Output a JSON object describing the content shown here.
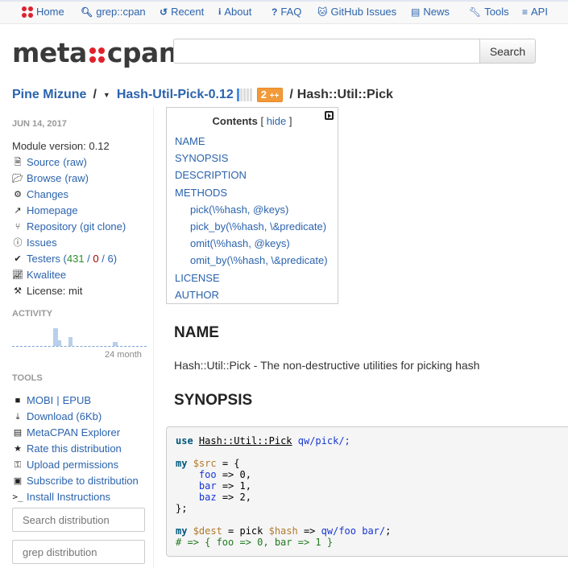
{
  "topnav": {
    "items": [
      {
        "label": "Home",
        "icon": "metacpan-dots-icon"
      },
      {
        "label": "grep::cpan",
        "icon": "search-icon"
      },
      {
        "label": "Recent",
        "icon": "history-icon"
      },
      {
        "label": "About",
        "icon": "info-icon"
      },
      {
        "label": "FAQ",
        "icon": "question-icon"
      },
      {
        "label": "GitHub Issues",
        "icon": "github-icon"
      },
      {
        "label": "News",
        "icon": "newspaper-icon"
      },
      {
        "label": "Tools",
        "icon": "wrench-icon"
      },
      {
        "label": "API",
        "icon": "database-icon"
      }
    ]
  },
  "header": {
    "logo_left": "meta",
    "logo_right": "cpan",
    "search_value": "",
    "search_button": "Search"
  },
  "breadcrumb": {
    "author": "Pine Mizune",
    "separator": "/",
    "release": "Hash-Util-Pick-0.12",
    "plusplus_count": "2",
    "plusplus_suffix": "++",
    "module": "Hash::Util::Pick",
    "rating_filled": 1,
    "rating_total": 5
  },
  "sidebar": {
    "date": "JUN 14, 2017",
    "module_version": "Module version: 0.12",
    "links": {
      "source": "Source",
      "source_raw": "(raw)",
      "browse": "Browse",
      "browse_raw": "(raw)",
      "changes": "Changes",
      "homepage": "Homepage",
      "repository": "Repository",
      "git_clone": "(git clone)",
      "issues": "Issues",
      "testers": "Testers",
      "testers_pass": "431",
      "testers_fail": "0",
      "testers_na": "6",
      "kwalitee": "Kwalitee",
      "license": "License: mit"
    },
    "activity_heading": "ACTIVITY",
    "activity_label": "24 month",
    "activity_values": [
      0,
      0,
      0,
      0,
      0,
      0,
      0,
      0,
      0,
      0,
      0,
      5,
      1.5,
      0,
      0,
      2.5,
      0,
      0,
      0,
      0,
      0,
      0,
      0,
      0,
      0,
      0,
      0,
      1.2,
      0,
      0,
      0,
      0,
      0,
      0,
      0,
      0
    ],
    "tools_heading": "TOOLS",
    "tools": {
      "mobi": "MOBI",
      "sep": "|",
      "epub": "EPUB",
      "download": "Download (6Kb)",
      "explorer": "MetaCPAN Explorer",
      "rate": "Rate this distribution",
      "permissions": "Upload permissions",
      "subscribe": "Subscribe to distribution",
      "install": "Install Instructions"
    },
    "search_dist_placeholder": "Search distribution",
    "grep_dist_placeholder": "grep distribution"
  },
  "toc": {
    "title": "Contents",
    "hide": "hide",
    "items": [
      {
        "label": "NAME",
        "sub": false
      },
      {
        "label": "SYNOPSIS",
        "sub": false
      },
      {
        "label": "DESCRIPTION",
        "sub": false
      },
      {
        "label": "METHODS",
        "sub": false
      },
      {
        "label": "pick(\\%hash, @keys)",
        "sub": true
      },
      {
        "label": "pick_by(\\%hash, \\&predicate)",
        "sub": true
      },
      {
        "label": "omit(\\%hash, @keys)",
        "sub": true
      },
      {
        "label": "omit_by(\\%hash, \\&predicate)",
        "sub": true
      },
      {
        "label": "LICENSE",
        "sub": false
      },
      {
        "label": "AUTHOR",
        "sub": false
      }
    ]
  },
  "content": {
    "name_heading": "NAME",
    "name_text": "Hash::Util::Pick - The non-destructive utilities for picking hash",
    "synopsis_heading": "SYNOPSIS",
    "code": {
      "use": "use",
      "module": "Hash::Util::Pick",
      "import": "qw/pick/;",
      "my": "my",
      "src": "$src",
      "eq_brace": " = {",
      "foo": "foo",
      "foo_val": " => 0,",
      "bar": "bar",
      "bar_val": " => 1,",
      "baz": "baz",
      "baz_val": " => 2,",
      "close": "};",
      "dest": "$dest",
      "pick_expr": " = pick ",
      "hash": "$hash",
      "arrow": " => ",
      "qw_foo_bar": "qw/foo bar/",
      "semicolon": ";",
      "comment": "# => { foo => 0, bar => 1 }"
    }
  }
}
